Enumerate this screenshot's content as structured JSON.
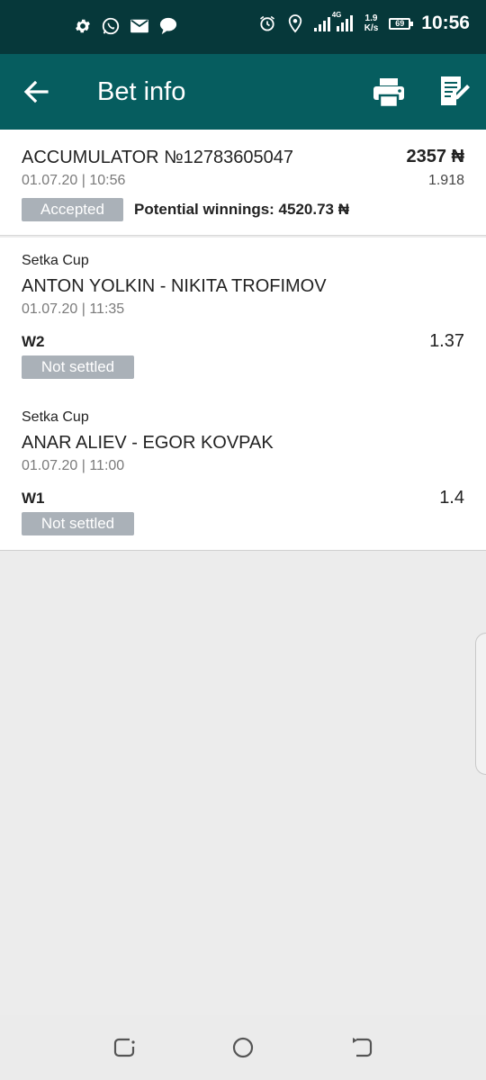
{
  "status_bar": {
    "time": "10:56",
    "network_label": "4G",
    "speed_value": "1.9",
    "speed_unit": "K/s",
    "battery_level": "69",
    "left_icons": [
      "gear-icon",
      "whatsapp-icon",
      "mail-icon",
      "chat-bubble-icon"
    ],
    "right_icons": [
      "alarm-icon",
      "location-icon",
      "signal-icon"
    ]
  },
  "app_bar": {
    "title": "Bet info",
    "back_icon": "arrow-left-icon",
    "print_icon": "printer-icon",
    "edit_icon": "edit-note-icon",
    "color": "#065d5f"
  },
  "bet": {
    "title": "ACCUMULATOR №12783605047",
    "stake": "2357 ₦",
    "date": "01.07.20 | 10:56",
    "coefficient": "1.918",
    "status": "Accepted",
    "potential_winnings": "Potential winnings: 4520.73 ₦"
  },
  "events": [
    {
      "tournament": "Setka Cup",
      "teams": "ANTON YOLKIN - NIKITA TROFIMOV",
      "date": "01.07.20 | 11:35",
      "pick": "W2",
      "coefficient": "1.37",
      "status": "Not settled"
    },
    {
      "tournament": "Setka Cup",
      "teams": "ANAR ALIEV - EGOR KOVPAK",
      "date": "01.07.20 | 11:00",
      "pick": "W1",
      "coefficient": "1.4",
      "status": "Not settled"
    }
  ],
  "colors": {
    "status_bar": "#06383a",
    "badge": "#aab1b8",
    "background": "#ececec"
  },
  "nav_bar": {
    "icons": [
      "recent-apps-icon",
      "home-icon",
      "back-icon"
    ]
  }
}
